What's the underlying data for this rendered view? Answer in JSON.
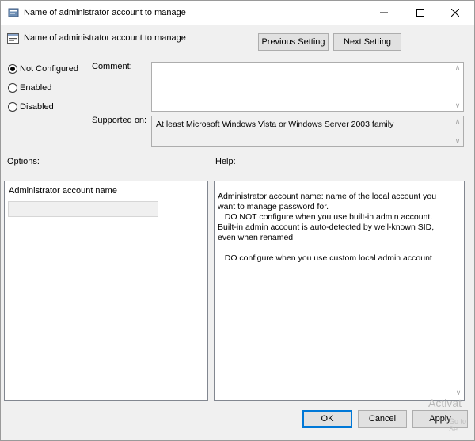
{
  "window": {
    "title": "Name of administrator account to manage",
    "minimize_icon": "minimize-icon",
    "maximize_icon": "maximize-icon",
    "close_icon": "close-icon"
  },
  "header": {
    "title": "Name of administrator account to manage",
    "previous_setting": "Previous Setting",
    "next_setting": "Next Setting"
  },
  "state": {
    "options": [
      {
        "label": "Not Configured",
        "selected": true
      },
      {
        "label": "Enabled",
        "selected": false
      },
      {
        "label": "Disabled",
        "selected": false
      }
    ]
  },
  "comment": {
    "label": "Comment:",
    "value": ""
  },
  "supported": {
    "label": "Supported on:",
    "value": "At least Microsoft Windows Vista or Windows Server 2003 family"
  },
  "options_section": {
    "label": "Options:",
    "field_label": "Administrator account name",
    "field_value": ""
  },
  "help_section": {
    "label": "Help:",
    "text": "Administrator account name: name of the local account you want to manage password for.\n   DO NOT configure when you use built-in admin account. Built-in admin account is auto-detected by well-known SID, even when renamed\n\n   DO configure when you use custom local admin account"
  },
  "footer": {
    "ok": "OK",
    "cancel": "Cancel",
    "apply": "Apply"
  },
  "watermark": {
    "line1": "Activat",
    "line2": "Go to Se"
  },
  "colors": {
    "dialog_bg": "#f0f0f0",
    "accent": "#0078d7"
  }
}
